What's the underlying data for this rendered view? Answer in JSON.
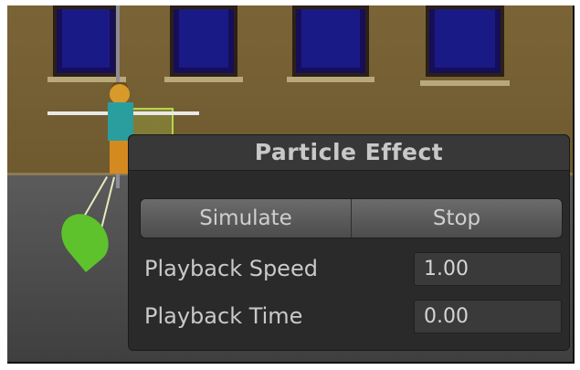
{
  "panel": {
    "title": "Particle Effect",
    "buttons": {
      "simulate": "Simulate",
      "stop": "Stop"
    },
    "rows": [
      {
        "label": "Playback Speed",
        "value": "1.00"
      },
      {
        "label": "Playback Time",
        "value": "0.00"
      }
    ]
  },
  "colors": {
    "panel_bg": "#2a2a2a",
    "wall": "#7a6437",
    "window_glass": "#1a1a86",
    "gizmo_green": "#5ec22c"
  }
}
